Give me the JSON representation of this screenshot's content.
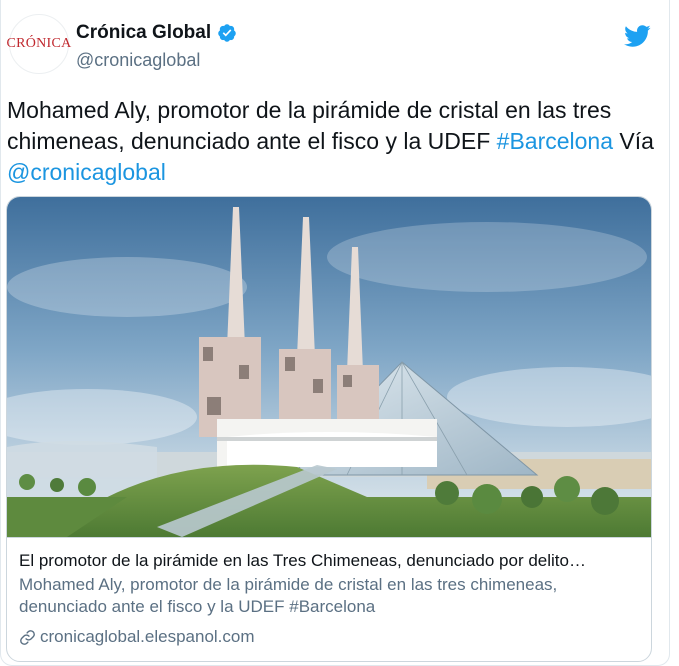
{
  "author": {
    "display_name": "Crónica Global",
    "handle": "@cronicaglobal",
    "avatar_text": "CRÓNICA",
    "verified": true
  },
  "tweet": {
    "text_main": "Mohamed Aly, promotor de la pirámide de cristal en las tres chimeneas, denunciado ante el fisco y la UDEF ",
    "hashtag": "#Barcelona",
    "via_text": " Vía ",
    "mention": "@cronicaglobal"
  },
  "card": {
    "title": "El promotor de la pirámide en las Tres Chimeneas, denunciado por delito…",
    "description": "Mohamed Aly, promotor de la pirámide de cristal en las tres chimeneas, denunciado ante el fisco y la UDEF #Barcelona",
    "domain": "cronicaglobal.elespanol.com",
    "image_icon": "rendering-image"
  },
  "colors": {
    "accent": "#1b95e0",
    "twitter_blue": "#1da1f2",
    "brand_red": "#c0282e",
    "secondary_text": "#5b7083"
  },
  "icons": {
    "verified": "verified-badge-icon",
    "platform": "twitter-bird-icon",
    "link": "link-icon"
  }
}
